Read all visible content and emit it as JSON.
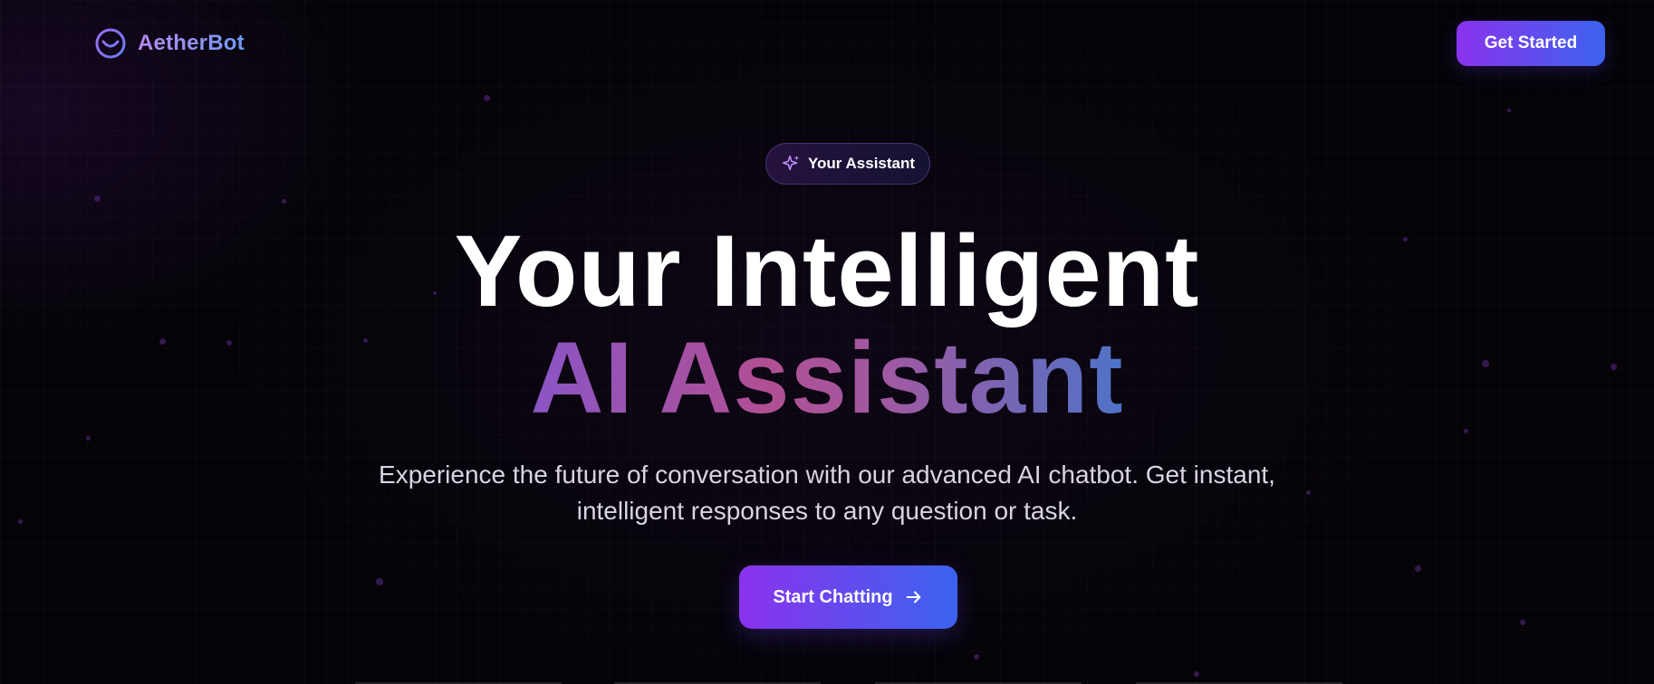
{
  "header": {
    "brand": "AetherBot",
    "cta_label": "Get Started"
  },
  "icons": {
    "logo": "smile-circle-icon",
    "badge": "sparkles-icon",
    "cta_arrow": "arrow-right-icon"
  },
  "hero": {
    "badge_label": "Your Assistant",
    "headline_line1": "Your Intelligent",
    "headline_line2": "AI Assistant",
    "subtitle": "Experience the future of conversation with our advanced AI chatbot. Get instant, intelligent responses to any question or task.",
    "cta_label": "Start Chatting"
  },
  "colors": {
    "background": "#050308",
    "accent_purple": "#8a33ec",
    "accent_blue": "#3b63ef",
    "logo_text_start": "#b689f2",
    "logo_text_end": "#6f9bf5"
  }
}
